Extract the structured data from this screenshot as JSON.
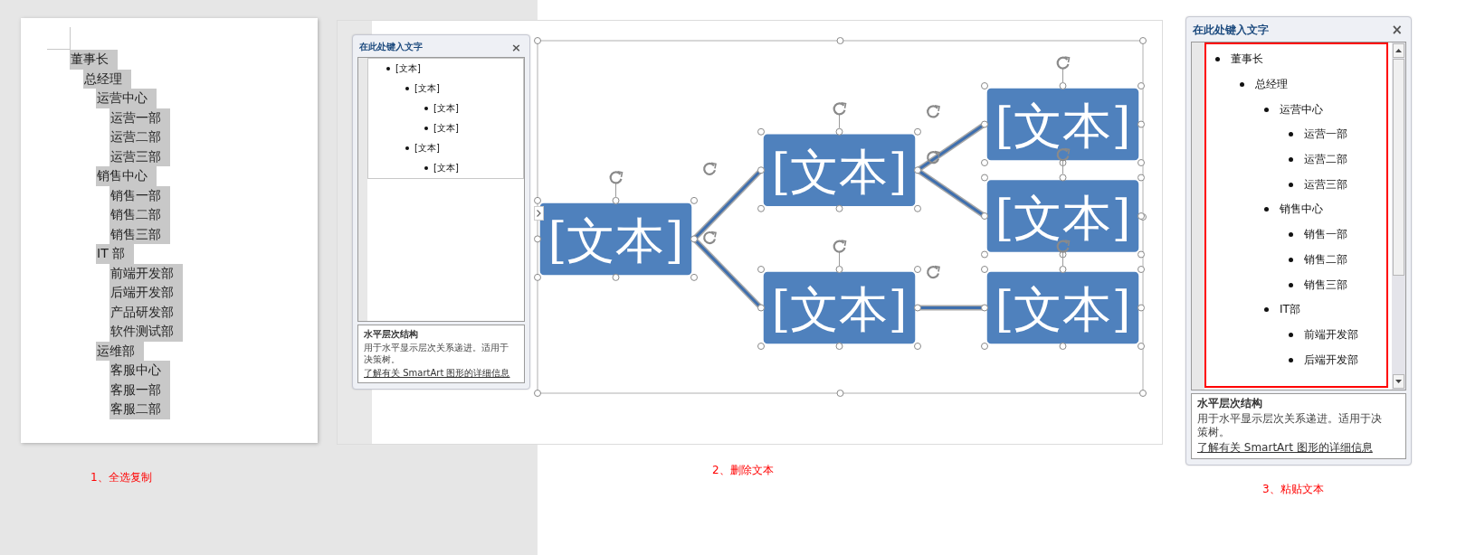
{
  "panels": [
    {
      "kind": "document",
      "caption": "1、全选复制",
      "document": {
        "lines": [
          {
            "text": "董事长",
            "selected": true,
            "children": [
              {
                "text": "总经理",
                "selected": true,
                "children": [
                  {
                    "text": "运营中心",
                    "selected": true,
                    "children": [
                      {
                        "text": "运营一部",
                        "selected": true
                      },
                      {
                        "text": "运营二部",
                        "selected": true
                      },
                      {
                        "text": "运营三部",
                        "selected": true
                      }
                    ]
                  },
                  {
                    "text": "销售中心",
                    "selected": true,
                    "children": [
                      {
                        "text": "销售一部",
                        "selected": true
                      },
                      {
                        "text": "销售二部",
                        "selected": true
                      },
                      {
                        "text": "销售三部",
                        "selected": true
                      }
                    ]
                  },
                  {
                    "text": "IT 部",
                    "selected": true,
                    "children": [
                      {
                        "text": "前端开发部",
                        "selected": true
                      },
                      {
                        "text": "后端开发部",
                        "selected": true
                      },
                      {
                        "text": "产品研发部",
                        "selected": true
                      },
                      {
                        "text": "软件测试部",
                        "selected": true
                      }
                    ]
                  },
                  {
                    "text": "运维部",
                    "selected": true,
                    "children": [
                      {
                        "text": "客服中心",
                        "selected": true
                      },
                      {
                        "text": "客服一部",
                        "selected": true
                      },
                      {
                        "text": "客服二部",
                        "selected": true
                      }
                    ]
                  }
                ]
              }
            ]
          }
        ]
      }
    },
    {
      "kind": "smartart",
      "caption": "2、删除文本",
      "text_pane": {
        "title": "在此处键入文字",
        "close": "×",
        "highlighted": false,
        "scrollable": false,
        "items": [
          {
            "text": "[文本]",
            "children": [
              {
                "text": "[文本]",
                "children": [
                  {
                    "text": "[文本]"
                  },
                  {
                    "text": "[文本]"
                  }
                ]
              },
              {
                "text": "[文本]",
                "children": [
                  {
                    "text": "[文本]"
                  }
                ]
              }
            ]
          }
        ],
        "layout_name": "水平层次结构",
        "description": "用于水平显示层次关系递进。适用于决策树。",
        "link": "了解有关 SmartArt 图形的详细信息"
      },
      "diagram": {
        "nodes": [
          {
            "label": "[文本]",
            "children": [
              {
                "label": "[文本]",
                "children": [
                  {
                    "label": "[文本]"
                  },
                  {
                    "label": "[文本]"
                  }
                ]
              },
              {
                "label": "[文本]",
                "children": [
                  {
                    "label": "[文本]"
                  }
                ]
              }
            ]
          }
        ]
      }
    },
    {
      "kind": "pane",
      "caption": "3、粘贴文本",
      "text_pane": {
        "title": "在此处键入文字",
        "close": "×",
        "highlighted": true,
        "scrollable": true,
        "items": [
          {
            "text": "董事长",
            "children": [
              {
                "text": "总经理",
                "children": [
                  {
                    "text": "运营中心",
                    "children": [
                      {
                        "text": "运营一部"
                      },
                      {
                        "text": "运营二部"
                      },
                      {
                        "text": "运营三部"
                      }
                    ]
                  },
                  {
                    "text": "销售中心",
                    "children": [
                      {
                        "text": "销售一部"
                      },
                      {
                        "text": "销售二部"
                      },
                      {
                        "text": "销售三部"
                      }
                    ]
                  },
                  {
                    "text": "IT部",
                    "children": [
                      {
                        "text": "前端开发部"
                      },
                      {
                        "text": "后端开发部"
                      }
                    ]
                  }
                ]
              }
            ]
          }
        ],
        "layout_name": "水平层次结构",
        "description": "用于水平显示层次关系递进。适用于决策树。",
        "link": "了解有关 SmartArt 图形的详细信息"
      }
    }
  ]
}
